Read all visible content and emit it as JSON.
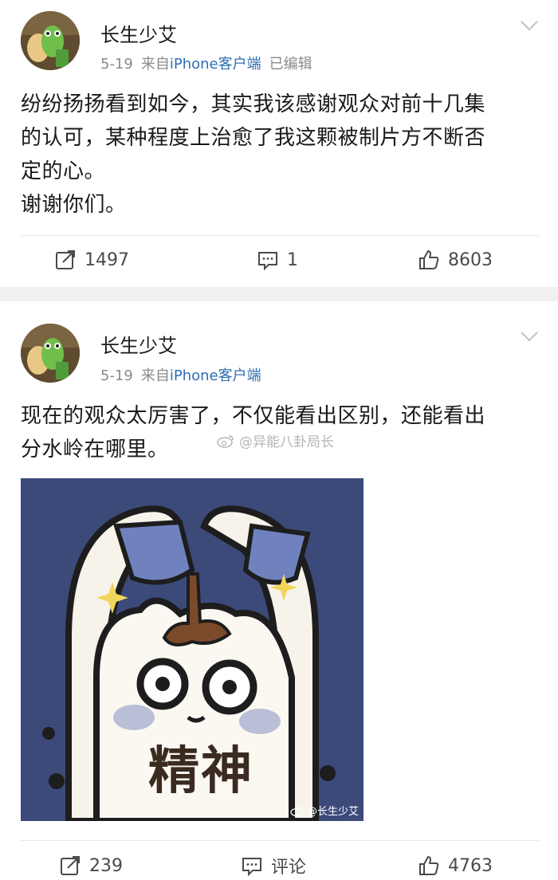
{
  "feed": {
    "posts": [
      {
        "author": "长生少艾",
        "date": "5-19",
        "source_prefix": "来自",
        "device": "iPhone客户端",
        "edited": "已编辑",
        "content_lines": [
          "纷纷扬扬看到如今，其实我该感谢观众对前十几集",
          "的认可，某种程度上治愈了我这颗被制片方不断否",
          "定的心。",
          "谢谢你们。"
        ],
        "reposts": "1497",
        "comments": "1",
        "likes": "8603"
      },
      {
        "author": "长生少艾",
        "date": "5-19",
        "source_prefix": "来自",
        "device": "iPhone客户端",
        "content_lines": [
          "现在的观众太厉害了，不仅能看出区别，还能看出",
          "分水岭在哪里。"
        ],
        "inline_watermark": "@异能八卦局长",
        "image": {
          "caption": "精神",
          "watermark": "@长生少艾"
        },
        "reposts": "239",
        "comments": "评论",
        "likes": "4763"
      }
    ]
  },
  "icons": {
    "repost": "repost-icon",
    "comment": "comment-icon",
    "like": "thumbs-up-icon",
    "more": "chevron-down-icon",
    "weibo": "weibo-logo-icon"
  },
  "colors": {
    "link_blue": "#2f6fb3",
    "meta_gray": "#8a8a8a",
    "separator": "#f1f1f1",
    "image_bg": "#3c4a7a"
  }
}
